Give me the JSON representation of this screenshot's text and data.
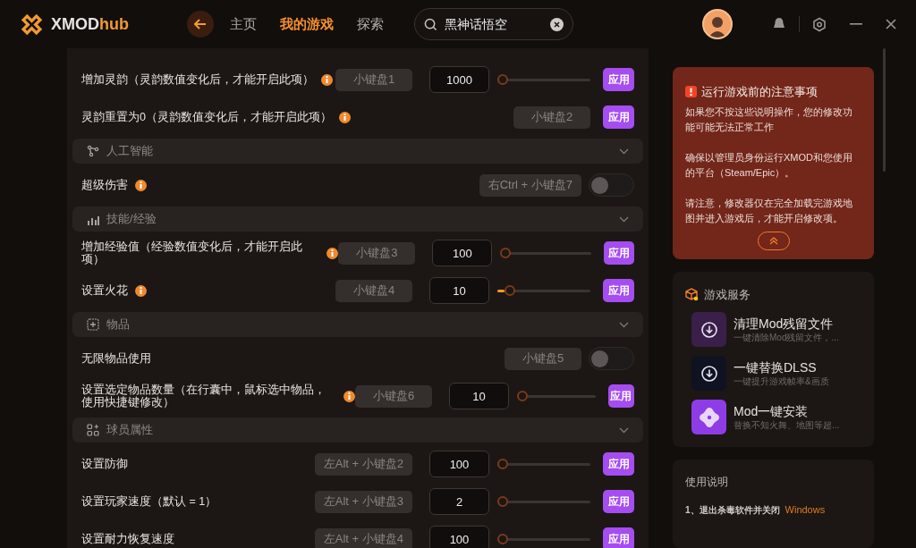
{
  "header": {
    "brand": {
      "main": "XMOD",
      "accent": "hub"
    },
    "nav": [
      {
        "label": "主页",
        "selected": false
      },
      {
        "label": "我的游戏",
        "selected": true
      },
      {
        "label": "探索",
        "selected": false
      }
    ],
    "search": {
      "value": "黑神话悟空"
    }
  },
  "options": [
    {
      "kind": "value",
      "label": "增加灵韵（灵韵数值变化后，才能开启此项）",
      "info": true,
      "hotkey": "小键盘1",
      "value": "1000",
      "level": 0,
      "button": "应用"
    },
    {
      "kind": "action",
      "label": "灵韵重置为0（灵韵数值变化后，才能开启此项）",
      "info": true,
      "hotkey": "小键盘2",
      "button": "应用"
    },
    {
      "kind": "section",
      "label": "人工智能",
      "expanded": false
    },
    {
      "kind": "toggle",
      "label": "超级伤害",
      "info": true,
      "hotkey": "右Ctrl + 小键盘7",
      "on": false
    },
    {
      "kind": "section",
      "label": "技能/经验",
      "expanded": false
    },
    {
      "kind": "value",
      "label": "增加经验值（经验数值变化后，才能开启此项）",
      "info": true,
      "hotkey": "小键盘3",
      "value": "100",
      "level": 0,
      "button": "应用"
    },
    {
      "kind": "value",
      "label": "设置火花",
      "info": true,
      "hotkey": "小键盘4",
      "value": "10",
      "level": 0.08,
      "button": "应用"
    },
    {
      "kind": "section",
      "label": "物品",
      "expanded": false
    },
    {
      "kind": "toggle",
      "label": "无限物品使用",
      "info": false,
      "hotkey": "小键盘5",
      "on": false
    },
    {
      "kind": "value",
      "label": "设置选定物品数量（在行囊中，鼠标选中物品，使用快捷键修改）",
      "info": true,
      "hotkey": "小键盘6",
      "value": "10",
      "level": 0,
      "button": "应用"
    },
    {
      "kind": "section",
      "label": "球员属性",
      "expanded": false
    },
    {
      "kind": "value",
      "label": "设置防御",
      "info": false,
      "hotkey": "左Alt + 小键盘2",
      "value": "100",
      "level": 0,
      "button": "应用"
    },
    {
      "kind": "value",
      "label": "设置玩家速度（默认 = 1）",
      "info": false,
      "hotkey": "左Alt + 小键盘3",
      "value": "2",
      "level": 0,
      "button": "应用"
    },
    {
      "kind": "value",
      "label": "设置耐力恢复速度",
      "info": false,
      "hotkey": "左Alt + 小键盘4",
      "value": "100",
      "level": 0,
      "button": "应用"
    }
  ],
  "notice": {
    "title": "运行游戏前的注意事项",
    "paragraphs": [
      "如果您不按这些说明操作，您的修改功能可能无法正常工作",
      "确保以管理员身份运行XMOD和您使用的平台（Steam/Epic）。",
      "请注意，修改器仅在完全加载完游戏地图并进入游戏后，才能开启修改项。"
    ]
  },
  "services": {
    "title": "游戏服务",
    "items": [
      {
        "kind": "clean",
        "title": "清理Mod残留文件",
        "subtitle": "一键清除Mod残留文件，..."
      },
      {
        "kind": "dlss",
        "title": "一键替换DLSS",
        "subtitle": "一键提升游戏帧率&画质"
      },
      {
        "kind": "install",
        "title": "Mod一键安装",
        "subtitle": "替换不知火舞、地图等超..."
      }
    ]
  },
  "instructions": {
    "title": "使用说明",
    "first_step": "1、退出杀毒软件并关闭",
    "highlight": "Windows"
  }
}
